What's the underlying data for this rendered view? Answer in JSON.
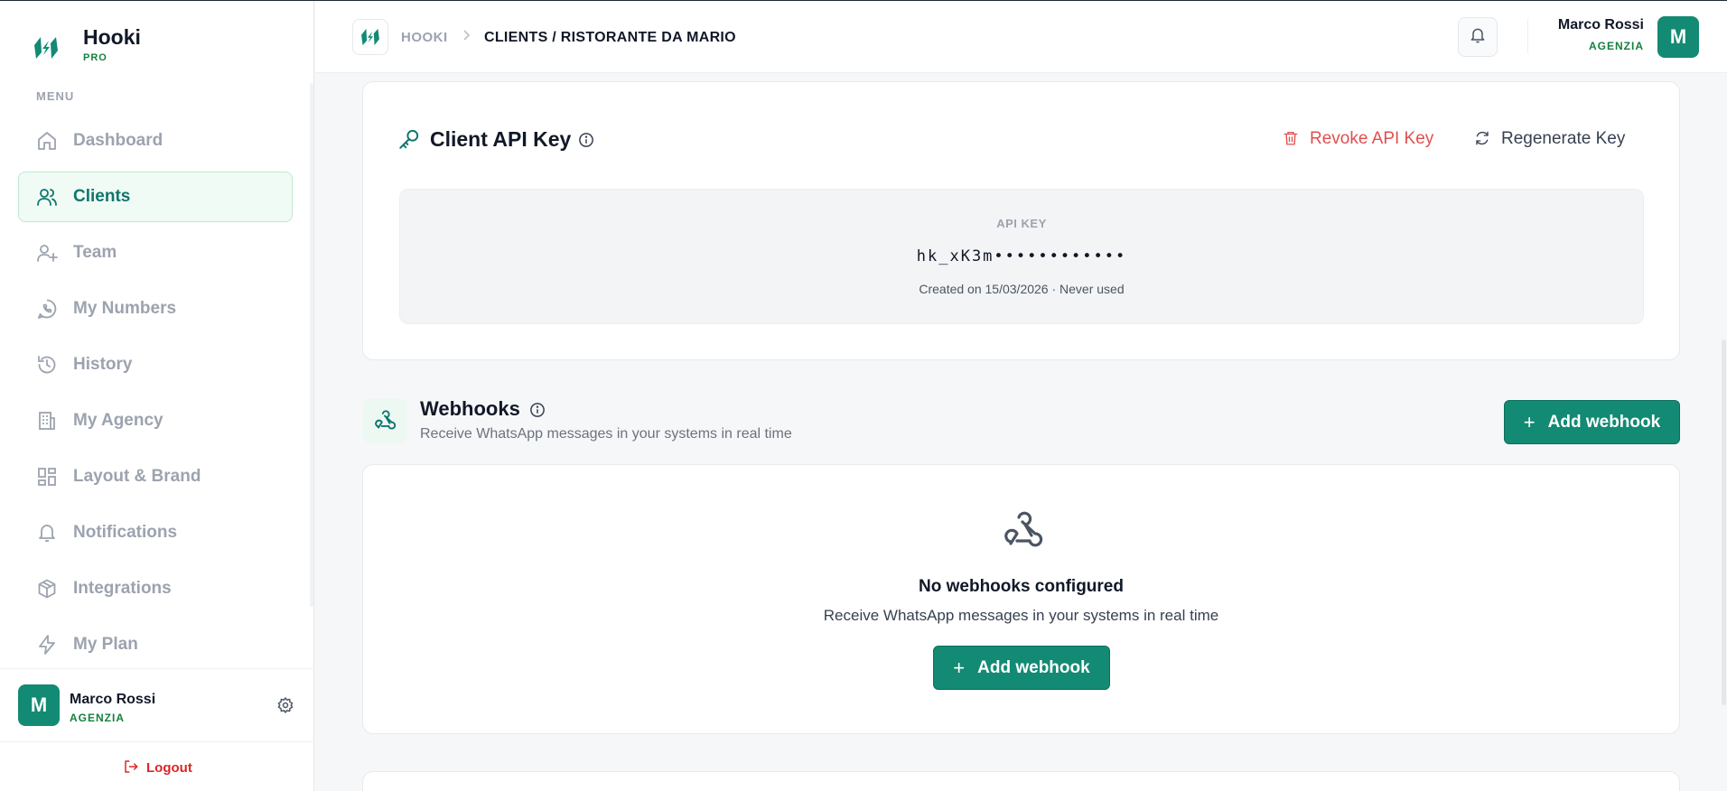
{
  "brand": {
    "name": "Hooki",
    "tier": "PRO"
  },
  "sidebar": {
    "menu_label": "MENU",
    "items": [
      {
        "label": "Dashboard",
        "icon": "home-icon"
      },
      {
        "label": "Clients",
        "icon": "users-icon",
        "active": true
      },
      {
        "label": "Team",
        "icon": "user-plus-icon"
      },
      {
        "label": "My Numbers",
        "icon": "whatsapp-icon"
      },
      {
        "label": "History",
        "icon": "history-icon"
      },
      {
        "label": "My Agency",
        "icon": "building-icon"
      },
      {
        "label": "Layout & Brand",
        "icon": "layout-icon"
      },
      {
        "label": "Notifications",
        "icon": "bell-icon"
      },
      {
        "label": "Integrations",
        "icon": "package-icon"
      },
      {
        "label": "My Plan",
        "icon": "zap-icon"
      }
    ],
    "user": {
      "initial": "M",
      "name": "Marco Rossi",
      "role": "AGENZIA"
    },
    "logout_label": "Logout"
  },
  "header": {
    "breadcrumb": [
      "HOOKI",
      "CLIENTS / RISTORANTE DA MARIO"
    ],
    "user": {
      "initial": "M",
      "name": "Marco Rossi",
      "role": "AGENZIA"
    }
  },
  "api_key": {
    "title": "Client API Key",
    "revoke_label": "Revoke API Key",
    "regenerate_label": "Regenerate Key",
    "box_label": "API KEY",
    "value": "hk_xK3m••••••••••••",
    "meta": "Created on 15/03/2026 · Never used"
  },
  "webhooks": {
    "title": "Webhooks",
    "subtitle": "Receive WhatsApp messages in your systems in real time",
    "add_label": "Add webhook",
    "empty_title": "No webhooks configured",
    "empty_subtitle": "Receive WhatsApp messages in your systems in real time",
    "empty_add_label": "Add webhook"
  },
  "colors": {
    "accent": "#138a73",
    "active_text": "#0f766e",
    "danger": "#e04f4f",
    "muted": "#9ca3af"
  }
}
